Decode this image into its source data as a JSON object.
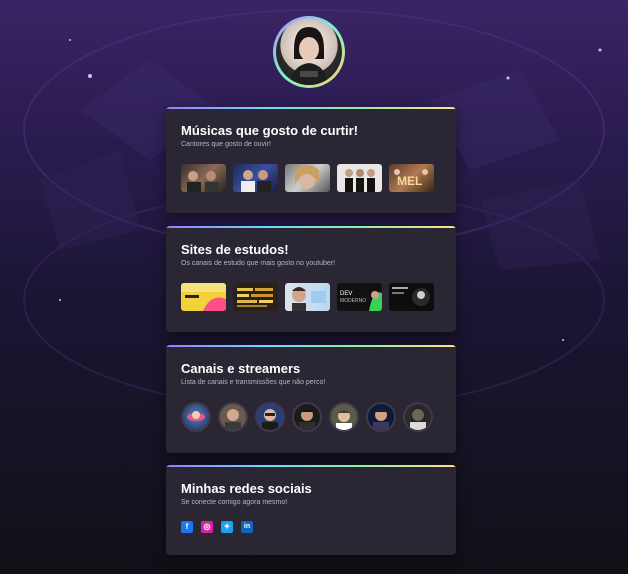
{
  "profile": {
    "avatar_alt": "Foto de perfil"
  },
  "sections": [
    {
      "title": "Músicas que gosto de curtir!",
      "subtitle": "Cantores que gosto de ouvir!",
      "items": [
        {
          "name": "cantor-1"
        },
        {
          "name": "cantor-2"
        },
        {
          "name": "cantor-3"
        },
        {
          "name": "cantor-4"
        },
        {
          "name": "cantor-5"
        }
      ]
    },
    {
      "title": "Sites de estudos!",
      "subtitle": "Os canais de estudo que mais gosto no youtuber!",
      "items": [
        {
          "name": "canal-estudo-1"
        },
        {
          "name": "canal-estudo-2"
        },
        {
          "name": "canal-estudo-3"
        },
        {
          "name": "canal-estudo-4"
        },
        {
          "name": "canal-estudo-5"
        }
      ]
    },
    {
      "title": "Canais e streamers",
      "subtitle": "Lista de canais e transmissões que não perco!",
      "items": [
        {
          "name": "streamer-1"
        },
        {
          "name": "streamer-2"
        },
        {
          "name": "streamer-3"
        },
        {
          "name": "streamer-4"
        },
        {
          "name": "streamer-5"
        },
        {
          "name": "streamer-6"
        },
        {
          "name": "streamer-7"
        }
      ]
    },
    {
      "title": "Minhas redes sociais",
      "subtitle": "Se conecte comigo agora mesmo!",
      "socials": [
        {
          "icon": "facebook-icon",
          "glyph": "f",
          "color": "#1877f2"
        },
        {
          "icon": "instagram-icon",
          "glyph": "◎",
          "color": "#d6249f"
        },
        {
          "icon": "twitter-icon",
          "glyph": "✦",
          "color": "#1da1f2"
        },
        {
          "icon": "linkedin-icon",
          "glyph": "in",
          "color": "#0a66c2"
        }
      ]
    }
  ]
}
